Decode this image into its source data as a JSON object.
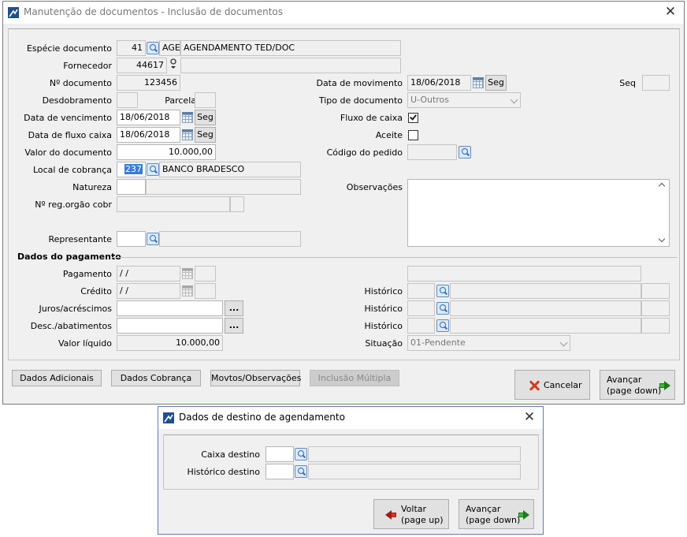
{
  "colors": {
    "accent": "#3a7bd5",
    "title_icon": "#1e4f8f"
  },
  "main_window": {
    "title": "Manutenção de documentos - Inclusão de documentos",
    "close": "✕",
    "fields": {
      "especie_label": "Espécie documento",
      "especie_code": "41",
      "especie_abbr": "AGE",
      "especie_desc": "AGENDAMENTO TED/DOC",
      "fornecedor_label": "Fornecedor",
      "fornecedor_code": "44617",
      "fornecedor_desc": "",
      "numero_label": "Nº documento",
      "numero_value": "123456",
      "data_mov_label": "Data de movimento",
      "data_mov_value": "18/06/2018",
      "data_mov_day": "Seg",
      "seq_label": "Seq",
      "seq_value": "",
      "desdobramento_label": "Desdobramento",
      "desdobramento_value": "",
      "parcela_label": "Parcela",
      "parcela_value": "",
      "tipo_doc_label": "Tipo de documento",
      "tipo_doc_value": "U-Outros",
      "data_venc_label": "Data de vencimento",
      "data_venc_value": "18/06/2018",
      "data_venc_day": "Seg",
      "fluxo_label": "Fluxo de caixa",
      "fluxo_checked": true,
      "data_fluxo_label": "Data de fluxo caixa",
      "data_fluxo_value": "18/06/2018",
      "data_fluxo_day": "Seg",
      "aceite_label": "Aceite",
      "aceite_checked": false,
      "valor_label": "Valor do documento",
      "valor_value": "10.000,00",
      "cod_pedido_label": "Código do pedido",
      "cod_pedido_value": "",
      "local_label": "Local de cobrança",
      "local_code": "237",
      "local_desc": "BANCO BRADESCO",
      "natureza_label": "Natureza",
      "natureza_value": "",
      "observacoes_label": "Observações",
      "observacoes_value": "",
      "reg_orgao_label": "Nº reg.orgão cobr",
      "representante_label": "Representante"
    },
    "pagamento": {
      "section_title": "Dados do pagamento",
      "pagamento_label": "Pagamento",
      "pagamento_value": " / /",
      "credito_label": "Crédito",
      "credito_value": " / /",
      "juros_label": "Juros/acréscimos",
      "desc_label": "Desc./abatimentos",
      "liquido_label": "Valor líquido",
      "liquido_value": "10.000,00",
      "historico_label": "Histórico",
      "situacao_label": "Situação",
      "situacao_value": "01-Pendente",
      "ellipsis": "..."
    },
    "buttons": {
      "dados_adicionais": "Dados Adicionais",
      "dados_cobranca": "Dados Cobrança",
      "movtos_obs": "Movtos/Observações",
      "inclusao_multipla": "Inclusão Múltipla",
      "cancelar": "Cancelar",
      "avancar_line1": "Avançar",
      "avancar_line2": "(page down)"
    }
  },
  "dialog": {
    "title": "Dados de destino de agendamento",
    "close": "✕",
    "caixa_label": "Caixa destino",
    "historico_label": "Histórico destino",
    "voltar_line1": "Voltar",
    "voltar_line2": "(page up)",
    "avancar_line1": "Avançar",
    "avancar_line2": "(page down)"
  }
}
